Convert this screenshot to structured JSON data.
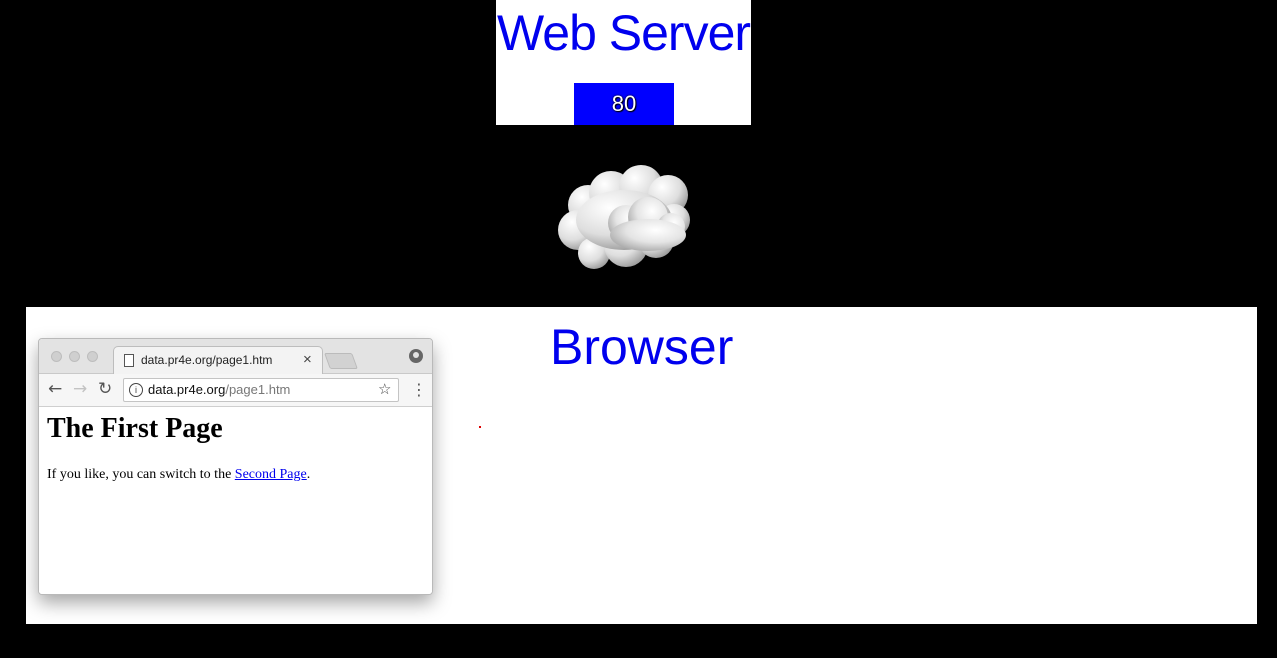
{
  "server": {
    "title": "Web Server",
    "port": "80"
  },
  "cloud": {
    "icon": "cloud-icon"
  },
  "browser_panel": {
    "label": "Browser"
  },
  "browser_window": {
    "tab": {
      "title": "data.pr4e.org/page1.htm",
      "close": "×"
    },
    "address": {
      "host": "data.pr4e.org",
      "path": "/page1.htm"
    },
    "icons": {
      "back": "←",
      "forward": "→",
      "reload": "↻",
      "info": "i",
      "star": "☆",
      "menu": "⋮"
    },
    "page": {
      "heading": "The First Page",
      "text_before": "If you like, you can switch to the ",
      "link_text": "Second Page",
      "text_after": "."
    }
  },
  "colors": {
    "accent": "#0000ee",
    "port_bg": "#0000ff",
    "background": "#000000"
  }
}
